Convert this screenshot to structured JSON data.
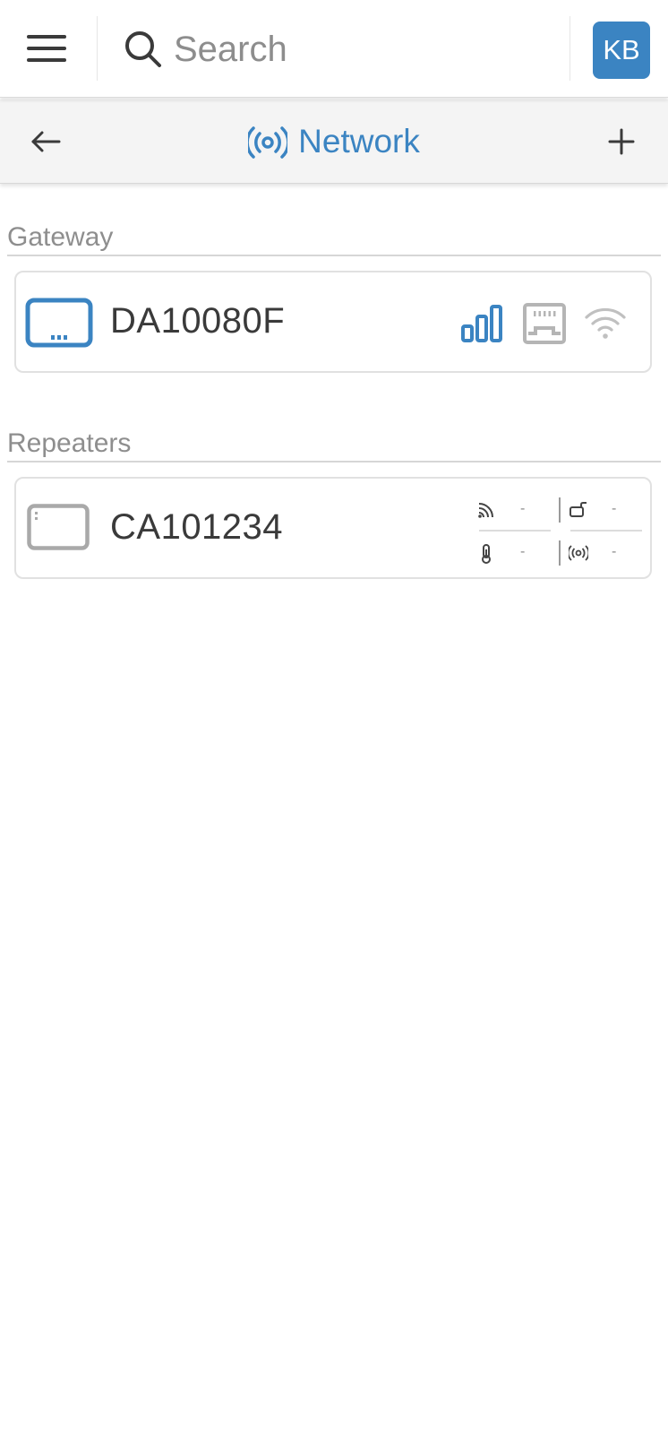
{
  "topbar": {
    "search_placeholder": "Search",
    "avatar_initials": "KB"
  },
  "subheader": {
    "title": "Network"
  },
  "sections": {
    "gateway": {
      "label": "Gateway",
      "device": {
        "name": "DA10080F",
        "icons": [
          "signal-bars-icon",
          "ethernet-port-icon",
          "wifi-icon"
        ],
        "active_icon": "signal-bars-icon"
      }
    },
    "repeaters": {
      "label": "Repeaters",
      "device": {
        "name": "CA101234",
        "stats": [
          {
            "icon": "rf-signal-icon",
            "value": "-"
          },
          {
            "icon": "battery-plug-icon",
            "value": "-"
          },
          {
            "icon": "thermometer-icon",
            "value": "-"
          },
          {
            "icon": "broadcast-icon",
            "value": "-"
          }
        ]
      }
    }
  },
  "colors": {
    "accent": "#3b84c2",
    "inactive_icon": "#b5b5b5",
    "section_label": "#8e8e8e"
  }
}
